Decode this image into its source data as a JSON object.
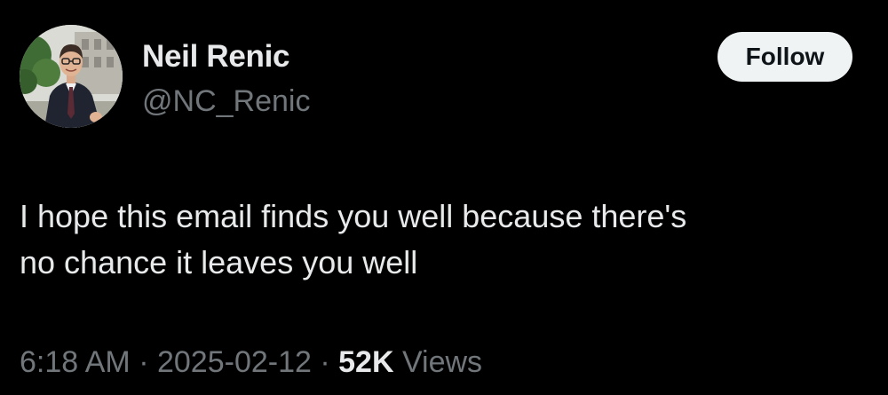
{
  "author": {
    "display_name": "Neil Renic",
    "handle": "@NC_Renic",
    "avatar_icon": "profile-photo"
  },
  "follow_button": {
    "label": "Follow"
  },
  "tweet": {
    "text_lines": [
      "I hope this email finds you well because there's",
      "no chance it leaves you well"
    ]
  },
  "meta": {
    "time": "6:18 AM",
    "separator": "·",
    "date": "2025-02-12",
    "views_count": "52K",
    "views_label": "Views"
  },
  "colors": {
    "background": "#000000",
    "primary_text": "#e7e9ea",
    "secondary_text": "#71767b",
    "button_bg": "#eff3f4",
    "button_text": "#0f1419"
  }
}
